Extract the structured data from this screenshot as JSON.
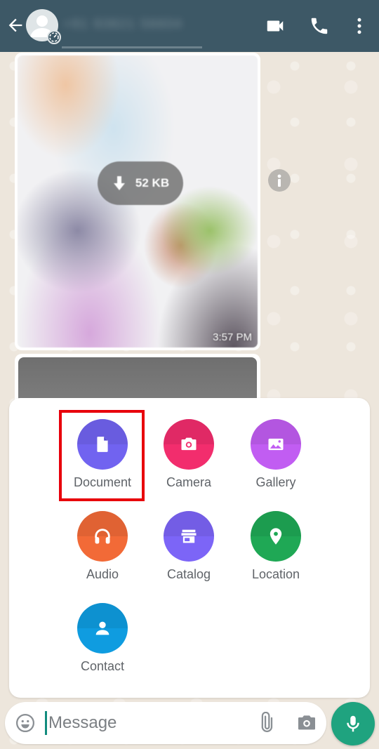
{
  "header": {
    "contact_name": "+91 93821 56604",
    "icons": [
      "back-arrow-icon",
      "avatar-icon",
      "status-icon",
      "video-call-icon",
      "voice-call-icon",
      "more-options-icon"
    ]
  },
  "messages": [
    {
      "type": "image",
      "download_size": "52 KB",
      "time": "3:57 PM"
    },
    {
      "type": "image",
      "partial": true
    }
  ],
  "attachment_menu": {
    "items": [
      {
        "label": "Document",
        "icon": "document-icon",
        "color": "#7163f0",
        "highlighted": true
      },
      {
        "label": "Camera",
        "icon": "camera-icon",
        "color": "#f22d6d"
      },
      {
        "label": "Gallery",
        "icon": "gallery-icon",
        "color": "#c15df2"
      },
      {
        "label": "Audio",
        "icon": "headphones-icon",
        "color": "#f26a37"
      },
      {
        "label": "Catalog",
        "icon": "store-icon",
        "color": "#7c65f7"
      },
      {
        "label": "Location",
        "icon": "location-pin-icon",
        "color": "#1fa855"
      },
      {
        "label": "Contact",
        "icon": "person-icon",
        "color": "#0f9ce0"
      }
    ]
  },
  "input_bar": {
    "placeholder": "Message",
    "value": ""
  },
  "colors": {
    "header_bg": "#3d5866",
    "accent_green": "#1fa37f",
    "highlight_red": "#e8000b"
  }
}
